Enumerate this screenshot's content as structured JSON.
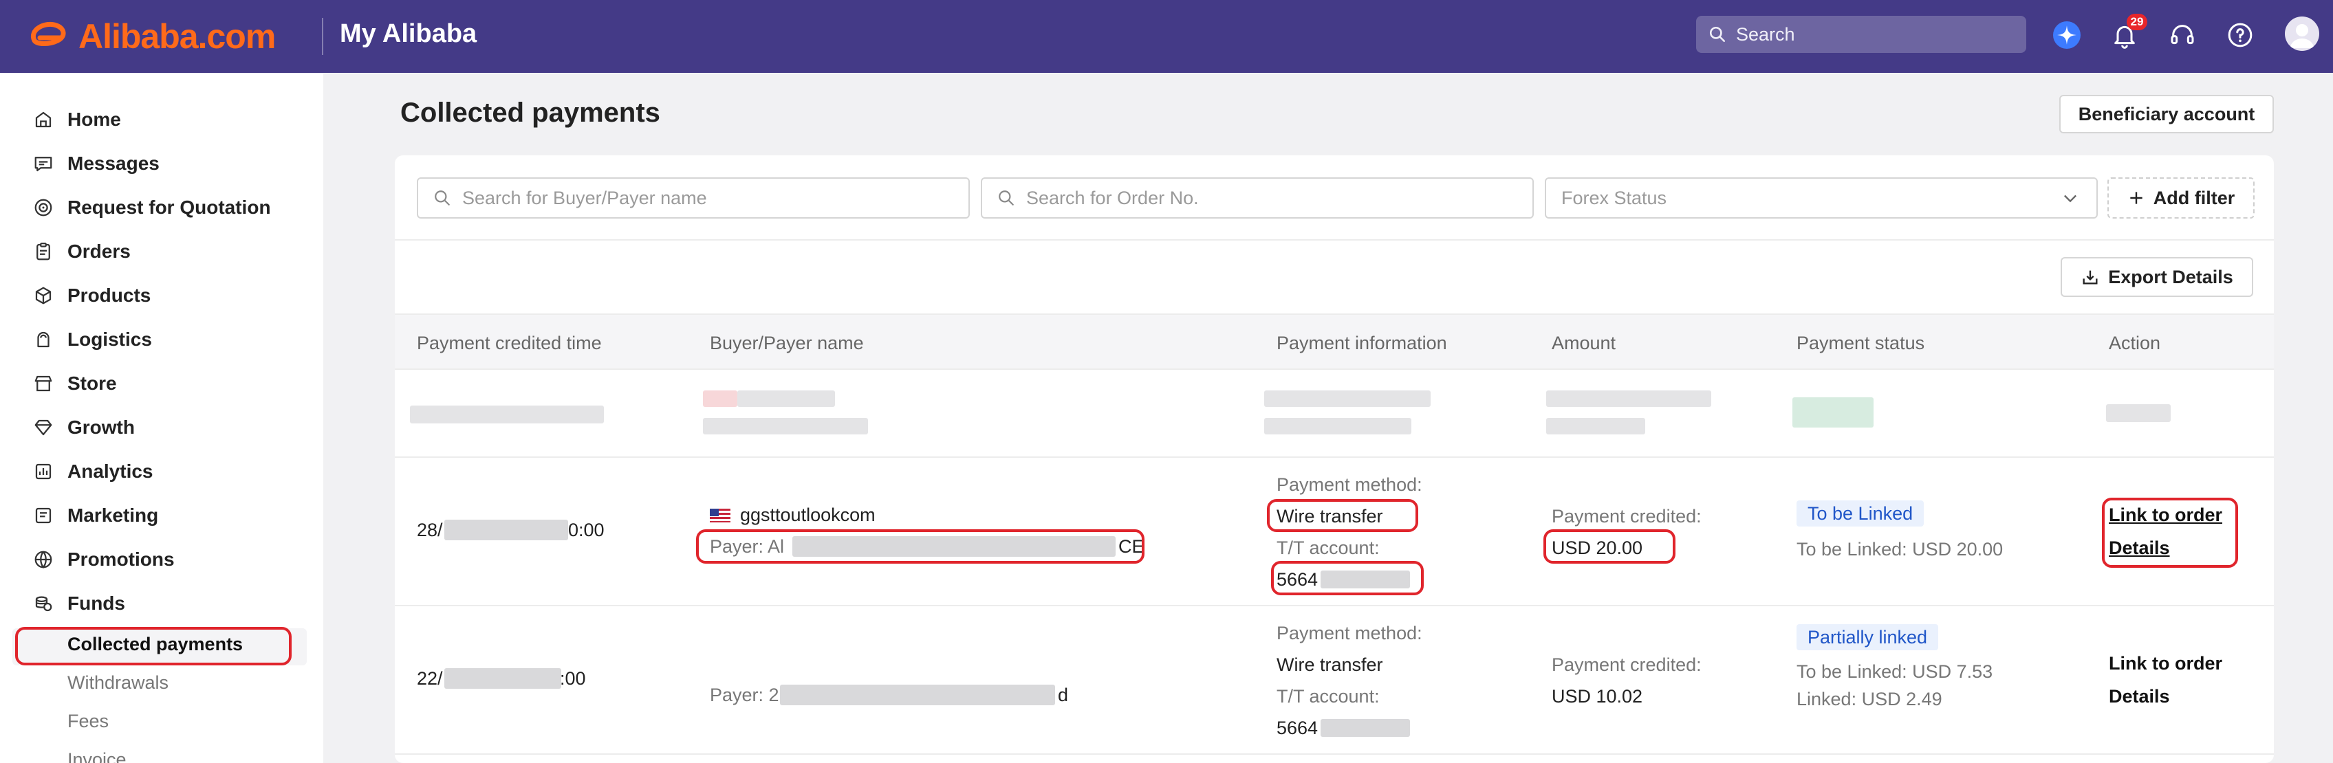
{
  "header": {
    "brand": "Alibaba.com",
    "section": "My Alibaba",
    "search_placeholder": "Search",
    "notification_count": "29"
  },
  "sidebar": {
    "items": [
      {
        "label": "Home",
        "icon": "home-icon"
      },
      {
        "label": "Messages",
        "icon": "message-icon"
      },
      {
        "label": "Request for Quotation",
        "icon": "target-icon"
      },
      {
        "label": "Orders",
        "icon": "clipboard-icon"
      },
      {
        "label": "Products",
        "icon": "cube-icon"
      },
      {
        "label": "Logistics",
        "icon": "truck-icon"
      },
      {
        "label": "Store",
        "icon": "store-icon"
      },
      {
        "label": "Growth",
        "icon": "diamond-icon"
      },
      {
        "label": "Analytics",
        "icon": "chart-icon"
      },
      {
        "label": "Marketing",
        "icon": "marketing-icon"
      },
      {
        "label": "Promotions",
        "icon": "globe-icon"
      },
      {
        "label": "Funds",
        "icon": "coins-icon"
      }
    ],
    "sub_items": [
      "Collected payments",
      "Withdrawals",
      "Fees",
      "Invoice"
    ]
  },
  "page": {
    "title": "Collected payments",
    "beneficiary_button": "Beneficiary account",
    "export_button": "Export Details"
  },
  "filters": {
    "buyer_placeholder": "Search for Buyer/Payer name",
    "order_placeholder": "Search for Order No.",
    "forex_placeholder": "Forex Status",
    "add_filter": "Add filter"
  },
  "table": {
    "columns": [
      "Payment credited time",
      "Buyer/Payer name",
      "Payment information",
      "Amount",
      "Payment status",
      "Action"
    ],
    "rows": [
      {
        "time_start": "28/",
        "time_end": "0:00",
        "buyer": "ggsttoutlookcom",
        "payer_prefix": "Payer: Al",
        "payer_suffix": "CE",
        "method_label": "Payment method:",
        "method": "Wire transfer",
        "account_label": "T/T account:",
        "account": "5664",
        "amount_label": "Payment credited:",
        "amount": "USD 20.00",
        "status": "To be Linked",
        "status_detail_1": "To be Linked: USD 20.00",
        "status_detail_2": "",
        "action_1": "Link to order",
        "action_2": "Details"
      },
      {
        "time_start": "22/",
        "time_end": ":00",
        "buyer": "",
        "payer_prefix": "Payer: 2",
        "payer_suffix": "d",
        "method_label": "Payment method:",
        "method": "Wire transfer",
        "account_label": "T/T account:",
        "account": "5664",
        "amount_label": "Payment credited:",
        "amount": "USD 10.02",
        "status": "Partially linked",
        "status_detail_1": "To be Linked: USD 7.53",
        "status_detail_2": "Linked: USD 2.49",
        "action_1": "Link to order",
        "action_2": "Details"
      }
    ]
  },
  "colors": {
    "header_bg": "#443a87",
    "brand_orange": "#ff6a1a",
    "highlight_red": "#e0252c",
    "status_blue": "#2056c8"
  }
}
